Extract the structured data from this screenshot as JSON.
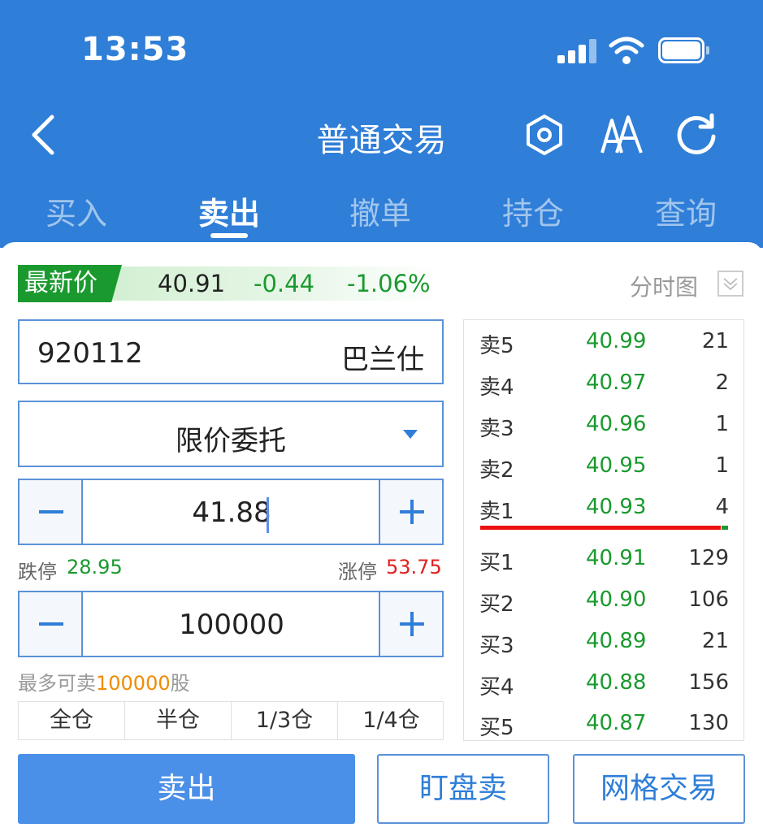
{
  "status_bar": {
    "time": "13:53"
  },
  "nav": {
    "title": "普通交易"
  },
  "tabs": [
    {
      "label": "买入"
    },
    {
      "label": "卖出"
    },
    {
      "label": "撤单"
    },
    {
      "label": "持仓"
    },
    {
      "label": "查询"
    }
  ],
  "active_tab": "卖出",
  "quote": {
    "latest_label": "最新价",
    "price": "40.91",
    "change": "-0.44",
    "change_pct": "-1.06%",
    "chart_link": "分时图"
  },
  "stock": {
    "code": "920112",
    "name": "巴兰仕"
  },
  "order_type": "限价委托",
  "order_price": "41.88",
  "limits": {
    "down_label": "跌停",
    "down_value": "28.95",
    "up_label": "涨停",
    "up_value": "53.75"
  },
  "quantity": "100000",
  "max_sell": {
    "prefix": "最多可卖",
    "qty": "100000",
    "suffix": "股"
  },
  "position_buttons": [
    "全仓",
    "半仓",
    "1/3仓",
    "1/4仓"
  ],
  "order_book": {
    "asks": [
      {
        "level": "卖5",
        "price": "40.99",
        "vol": "21"
      },
      {
        "level": "卖4",
        "price": "40.97",
        "vol": "2"
      },
      {
        "level": "卖3",
        "price": "40.96",
        "vol": "1"
      },
      {
        "level": "卖2",
        "price": "40.95",
        "vol": "1"
      },
      {
        "level": "卖1",
        "price": "40.93",
        "vol": "4"
      }
    ],
    "bids": [
      {
        "level": "买1",
        "price": "40.91",
        "vol": "129"
      },
      {
        "level": "买2",
        "price": "40.90",
        "vol": "106"
      },
      {
        "level": "买3",
        "price": "40.89",
        "vol": "21"
      },
      {
        "level": "买4",
        "price": "40.88",
        "vol": "156"
      },
      {
        "level": "买5",
        "price": "40.87",
        "vol": "130"
      }
    ]
  },
  "actions": {
    "sell": "卖出",
    "watch_sell": "盯盘卖",
    "grid_trade": "网格交易"
  },
  "colors": {
    "header": "#2f7ed8",
    "down": "#1a9a2e",
    "up": "#e02020",
    "accent": "#f08c00"
  }
}
